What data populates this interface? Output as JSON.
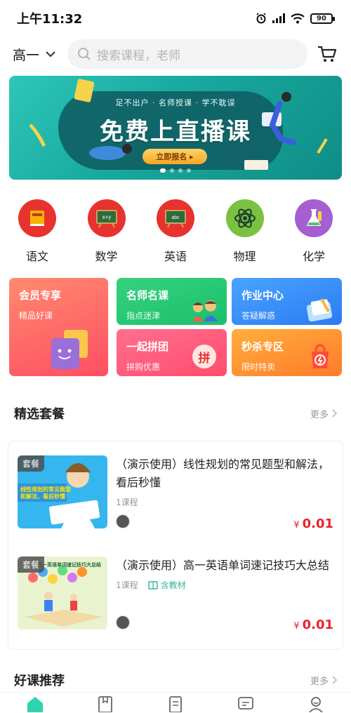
{
  "status": {
    "time": "上午11:32",
    "battery": "90"
  },
  "header": {
    "grade": "高一",
    "search_placeholder": "搜索课程，老师"
  },
  "banner": {
    "subtitle": "足不出户 · 名师授课 · 学不耽误",
    "title": "免费上直播课",
    "cta": "立即报名 ▸"
  },
  "subjects": [
    {
      "label": "语文",
      "icon": "book-icon",
      "color": "#e8322e"
    },
    {
      "label": "数学",
      "icon": "blackboard-icon",
      "color": "#e8322e"
    },
    {
      "label": "英语",
      "icon": "blackboard-icon",
      "color": "#e8322e"
    },
    {
      "label": "物理",
      "icon": "atom-icon",
      "color": "#7ac142"
    },
    {
      "label": "化学",
      "icon": "flask-icon",
      "color": "#a55fd1"
    }
  ],
  "features": {
    "member": {
      "title": "会员专享",
      "sub": "精品好课"
    },
    "teacher": {
      "title": "名师名课",
      "sub": "指点迷津"
    },
    "homework": {
      "title": "作业中心",
      "sub": "答疑解惑"
    },
    "group": {
      "title": "一起拼团",
      "sub": "拼购优惠",
      "badge": "拼"
    },
    "flash": {
      "title": "秒杀专区",
      "sub": "限时特卖"
    }
  },
  "sections": {
    "packages": {
      "title": "精选套餐",
      "more": "更多"
    },
    "recommend": {
      "title": "好课推荐",
      "more": "更多"
    }
  },
  "packages": [
    {
      "badge": "套餐",
      "thumb_text": "线性规划的常见题型和解法，看后秒懂",
      "title": "（演示使用）线性规划的常见题型和解法，看后秒懂",
      "count": "1课程",
      "material": "",
      "price_symbol": "¥",
      "price": "0.01"
    },
    {
      "badge": "套餐",
      "thumb_text": "高一英语单词速记技巧大总结",
      "title": "（演示使用）高一英语单词速记技巧大总结",
      "count": "1课程",
      "material": "含教材",
      "price_symbol": "¥",
      "price": "0.01"
    }
  ],
  "colors": {
    "accent": "#2db796",
    "price": "#e8222e"
  }
}
